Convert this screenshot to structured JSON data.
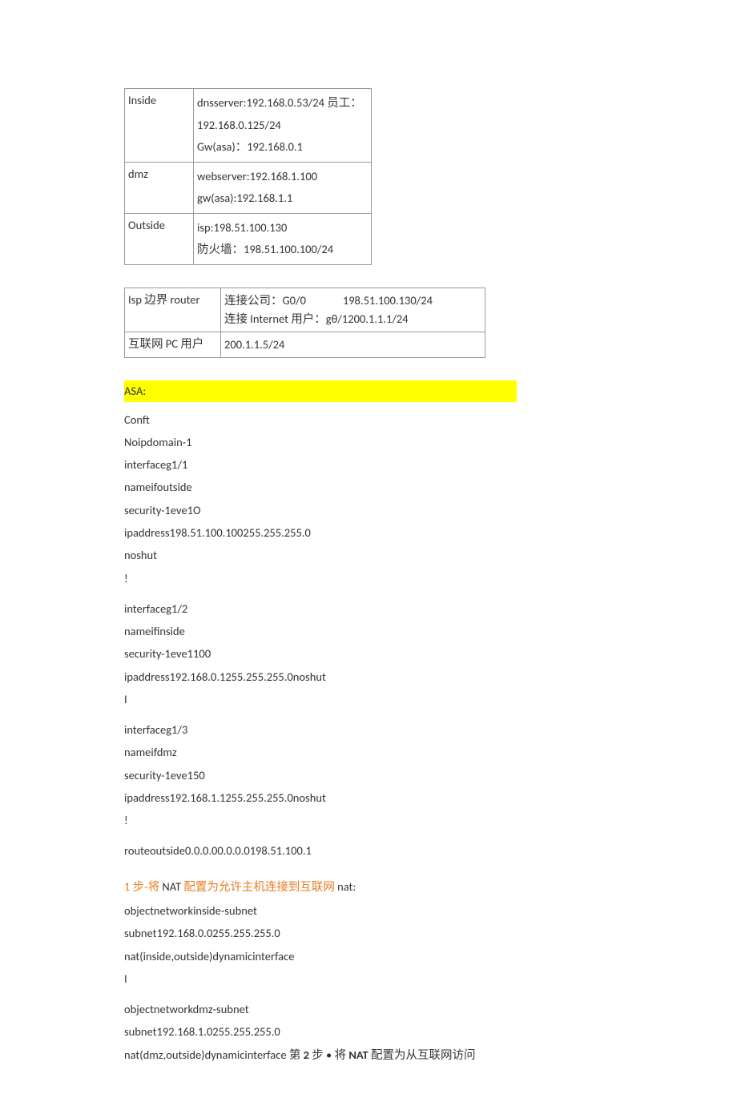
{
  "table1": {
    "rows": [
      {
        "c1": "Inside",
        "c2": "dnsserver:192.168.0.53/24 员工：192.168.0.125/24\nGw(asa)：192.168.0.1"
      },
      {
        "c1": "dmz",
        "c2": "webserver:192.168.1.100\ngw(asa):192.168.1.1"
      },
      {
        "c1": "Outside",
        "c2": "isp:198.51.100.130\n防火墙：198.51.100.100/24"
      }
    ]
  },
  "table2": {
    "rows": [
      {
        "c1": "Isp 边界 router",
        "c2_l1a": "连接公司：G0/0",
        "c2_l1b": "198.51.100.130/24",
        "c2_l2": "连接 Internet 用户：gθ/1200.1.1.1/24"
      },
      {
        "c1": "互联网 PC 用户",
        "c2": "200.1.1.5/24"
      }
    ]
  },
  "asa_header": "ASA:",
  "asa_code": {
    "l1": "Conft",
    "l2": "Noipdomain-1",
    "l3": "interfaceg1/1",
    "l4": "nameifoutside",
    "l5": "security-1eve1O",
    "l6": "ipaddress198.51.100.100255.255.255.0",
    "l7": "noshut",
    "l8": "!",
    "l9": "interfaceg1/2",
    "l10": "nameifinside",
    "l11": "security-1eve1100",
    "l12": "ipaddress192.168.0.1255.255.255.0noshut",
    "l13": "I",
    "l14": "interfaceg1/3",
    "l15": "nameifdmz",
    "l16": "security-1eve150",
    "l17": "ipaddress192.168.1.1255.255.255.0noshut",
    "l18": "!",
    "l19": "routeoutside0.0.0.00.0.0.0198.51.100.1"
  },
  "step1": {
    "orange1": "1 步-将",
    "black1": " NAT ",
    "orange2": "配置为允许主机连接到互联网",
    "black2": " nat:"
  },
  "nat_code": {
    "n1": "objectnetworkinside-subnet",
    "n2": "subnet192.168.0.0255.255.255.0",
    "n3": "nat(inside,outside)dynamicinterface",
    "n4": "I",
    "n5": "objectnetworkdmz-subnet",
    "n6": "subnet192.168.1.0255.255.255.0",
    "n7_part1": "nat(dmz,outside)dynamicinterface 第 ",
    "n7_bold1": "2",
    "n7_part2": " 步 • 将 ",
    "n7_bold2": "NAT",
    "n7_part3": " 配置为从互联网访问"
  }
}
